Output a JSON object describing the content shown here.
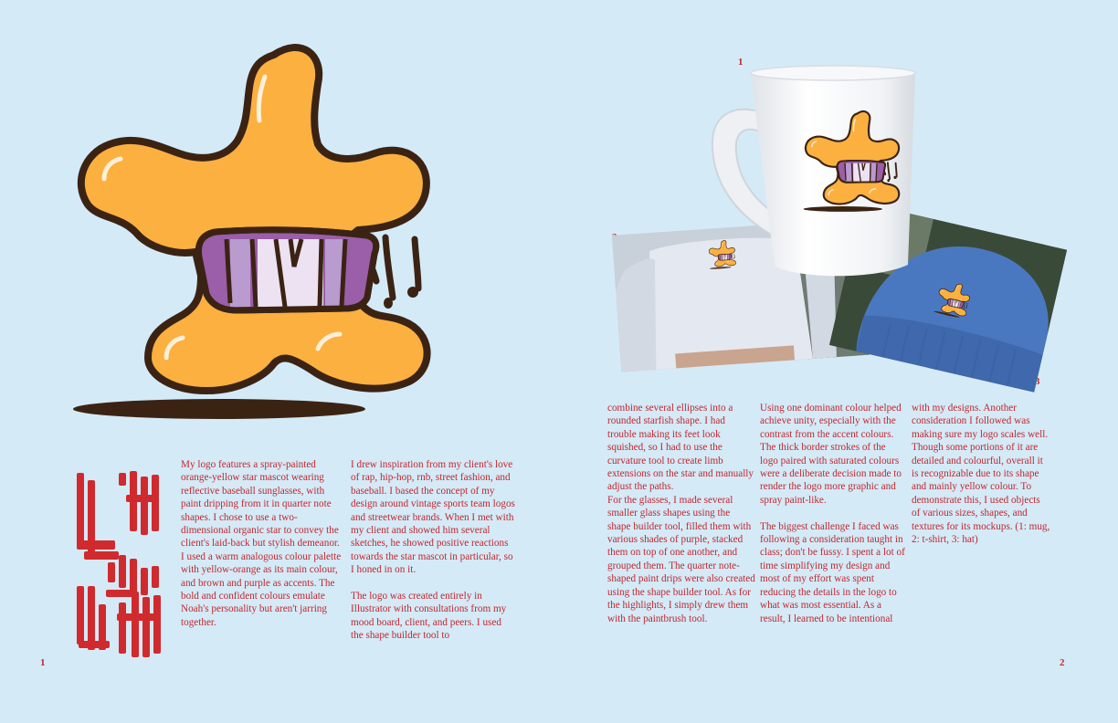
{
  "page_numbers": {
    "left": "1",
    "right": "2"
  },
  "mockup_labels": {
    "mug": "1",
    "tshirt": "2",
    "hat": "3"
  },
  "wordmark": "LOGO",
  "colors": {
    "background": "#d4eaf7",
    "text": "#c1272d",
    "mascot_orange": "#fbb040",
    "outline_brown": "#3b2314",
    "glasses_purple_dark": "#9b5ea8",
    "glasses_purple_mid": "#b99bd0",
    "glasses_purple_light": "#ece2f2"
  },
  "icons": [
    "star-mascot-logo",
    "sunglasses",
    "paint-drips",
    "mug-mockup",
    "tshirt-mockup",
    "beanie-mockup"
  ],
  "columns": [
    "My logo features a spray-painted orange-yellow star mascot wearing reflective baseball sunglasses, with paint dripping from it in quarter note shapes. I chose to use a two-dimensional organic star to convey the client's laid-back but stylish demeanor.  I used a warm analogous colour palette with yellow-orange as its main colour, and brown and purple as accents. The bold and confident colours emulate Noah's personality but aren't jarring together.",
    "I drew inspiration from my client's love of rap, hip-hop, rnb, street fashion, and baseball. I based the concept of my design around vintage sports team logos and streetwear brands. When I met with my client and showed him several sketches, he showed positive reactions towards the star mascot in particular, so I honed in on it.\n\nThe logo was created entirely in Illustrator with consultations from my mood board, client, and peers. I used the shape builder tool to",
    "combine several ellipses into a rounded starfish shape. I had trouble making its feet look squished, so I had to use the curvature tool to create limb extensions on the star and manually adjust the paths.\nFor the glasses, I made several smaller glass shapes using the shape builder tool, filled them with various shades of purple, stacked them on top of one another, and grouped them. The quarter note-shaped paint drips were also created using the shape builder tool.  As for the highlights, I simply drew them with the paintbrush tool.",
    "Using one dominant colour helped achieve unity, especially with the contrast from the accent colours. The thick border strokes of the logo paired with saturated colours were a deliberate decision made to render the logo more graphic and spray paint-like.\n\nThe biggest challenge I faced was following a consideration taught in class; don't be fussy. I spent a lot of time simplifying my design and most of my effort was spent reducing the details in the logo to what was most essential. As a result, I learned to be intentional",
    "with my designs. Another consideration I followed was making sure my logo scales well. Though some portions of it are detailed and colourful, overall it is recognizable due to its shape and mainly yellow colour. To demonstrate this, I used objects of various sizes, shapes, and textures for its mockups. (1: mug, 2: t-shirt, 3: hat)"
  ]
}
